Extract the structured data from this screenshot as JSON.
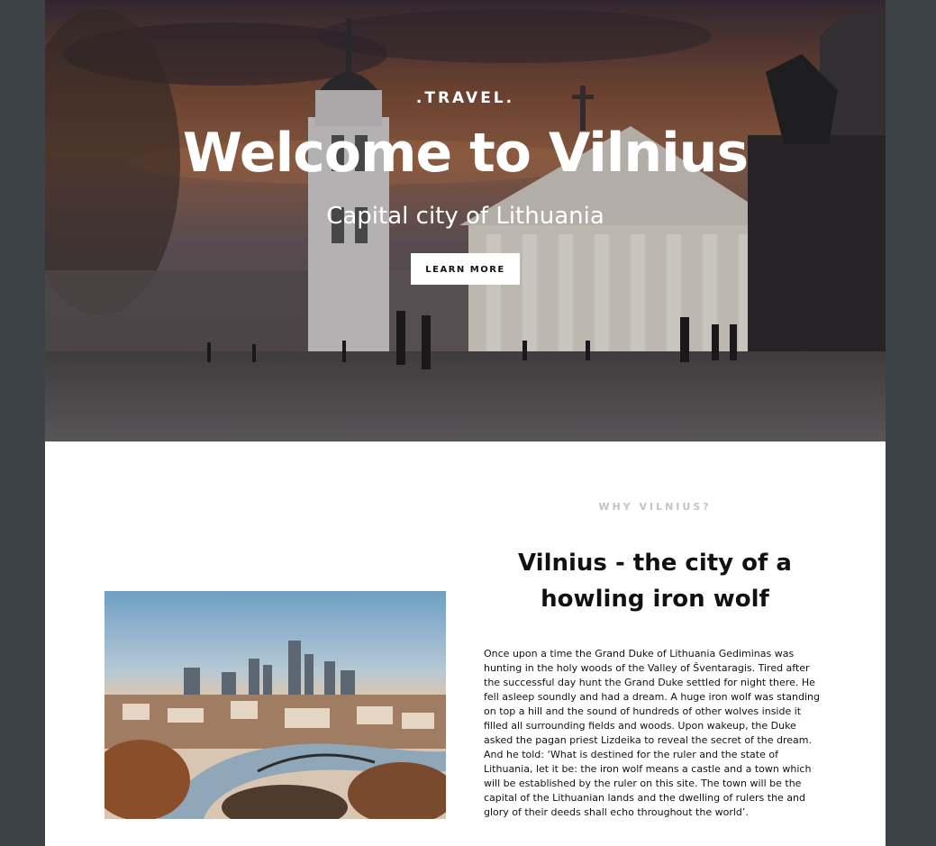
{
  "hero": {
    "brand": ".TRAVEL.",
    "title": "Welcome to Vilnius",
    "subtitle": "Capital city of Lithuania",
    "cta_label": "LEARN MORE",
    "image": "vilnius-cathedral-square-sunset-photo"
  },
  "about": {
    "eyebrow": "WHY VILNIUS?",
    "title": "Vilnius - the city of a howling iron wolf",
    "image": "vilnius-city-panorama-photo",
    "body": "Once upon a time the Grand Duke of Lithuania Gediminas was hunting in the holy woods of the Valley of Šventaragis. Tired after the successful day hunt the Grand Duke settled for night there. He fell asleep soundly and had a dream. A huge iron wolf was standing on top a hill and the sound of hundreds of other wolves inside it filled all surrounding fields and woods. Upon wakeup, the Duke asked the pagan priest Lizdeika to reveal the secret of the dream. And he told: ‘What is destined for the ruler and the state of Lithuania, let it be: the iron wolf means a castle and a town which will be established by the ruler on this site. The town will be the capital of the Lithuanian lands and the dwelling of rulers the and glory of their deeds shall echo throughout the world’."
  },
  "colors": {
    "page_background": "#3d4246",
    "content_background": "#ffffff",
    "eyebrow": "#c4c4c4",
    "text": "#111111"
  }
}
